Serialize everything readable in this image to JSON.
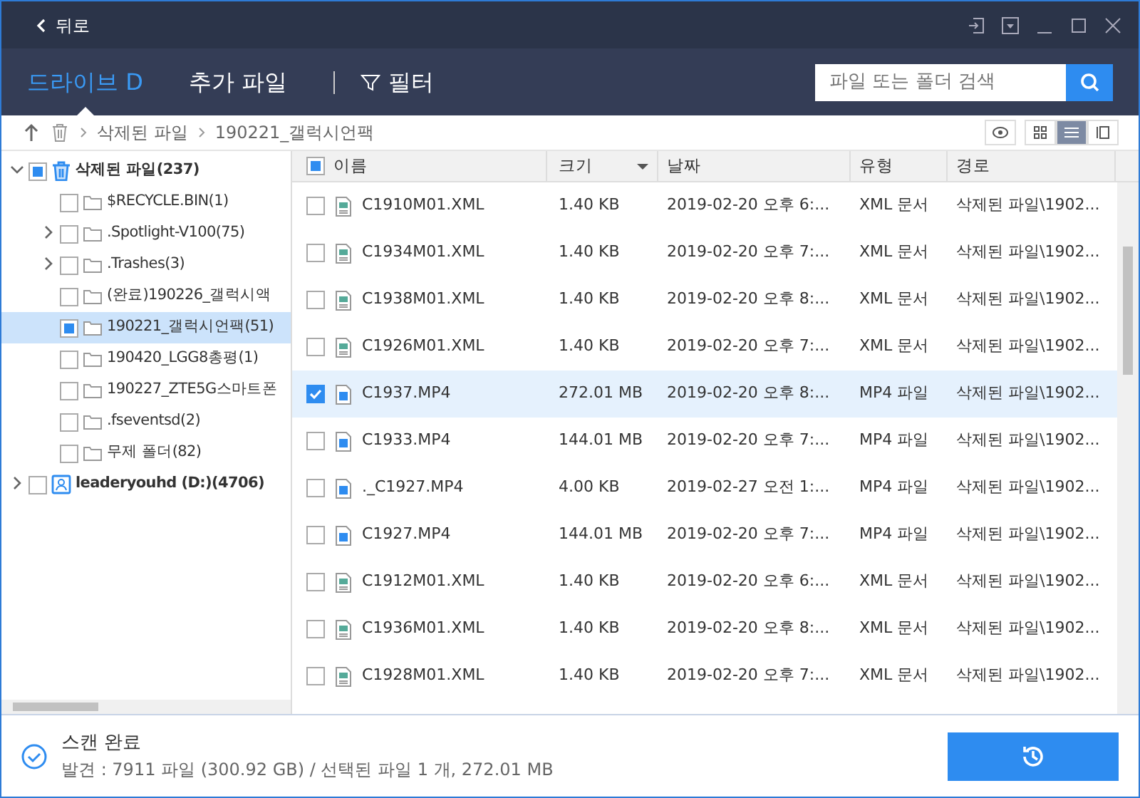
{
  "window": {
    "back_label": "뒤로"
  },
  "tabs": [
    {
      "label": "드라이브 D",
      "selected": true
    },
    {
      "label": "추가 파일",
      "selected": false
    }
  ],
  "filter": {
    "label": "필터"
  },
  "search": {
    "placeholder": "파일 또는 폴더 검색"
  },
  "breadcrumb": [
    "삭제된 파일",
    "190221_갤럭시언팩"
  ],
  "view_modes": [
    {
      "kind": "grid",
      "selected": false
    },
    {
      "kind": "list",
      "selected": true
    },
    {
      "kind": "preview",
      "selected": false
    }
  ],
  "tree": [
    {
      "label": "삭제된 파일(237)",
      "kind": "trash",
      "expanded": true,
      "checked": false,
      "indeterminate": true,
      "selected": false,
      "children": [
        {
          "label": "$RECYCLE.BIN(1)",
          "expandable": false,
          "checked": false,
          "indeterminate": false,
          "selected": false
        },
        {
          "label": ".Spotlight-V100(75)",
          "expandable": true,
          "checked": false,
          "indeterminate": false,
          "selected": false
        },
        {
          "label": ".Trashes(3)",
          "expandable": true,
          "checked": false,
          "indeterminate": false,
          "selected": false
        },
        {
          "label": "(완료)190226_갤럭시액",
          "expandable": false,
          "checked": false,
          "indeterminate": false,
          "selected": false
        },
        {
          "label": "190221_갤럭시언팩(51)",
          "expandable": false,
          "checked": false,
          "indeterminate": true,
          "selected": true
        },
        {
          "label": "190420_LGG8총평(1)",
          "expandable": false,
          "checked": false,
          "indeterminate": false,
          "selected": false
        },
        {
          "label": "190227_ZTE5G스마트폰",
          "expandable": false,
          "checked": false,
          "indeterminate": false,
          "selected": false
        },
        {
          "label": ".fseventsd(2)",
          "expandable": false,
          "checked": false,
          "indeterminate": false,
          "selected": false
        },
        {
          "label": "무제 폴더(82)",
          "expandable": false,
          "checked": false,
          "indeterminate": false,
          "selected": false
        }
      ]
    },
    {
      "label": "leaderyouhd (D:)(4706)",
      "kind": "drive",
      "expanded": false,
      "checked": false,
      "indeterminate": false,
      "selected": false
    }
  ],
  "table": {
    "header_checked": false,
    "header_indeterminate": true,
    "columns": [
      "이름",
      "크기",
      "날짜",
      "유형",
      "경로"
    ],
    "rows": [
      {
        "kind": "xml",
        "checked": false,
        "selected": false,
        "cells": [
          "C1910M01.XML",
          "1.40 KB",
          "2019-02-20 오후 6:...",
          "XML 문서",
          "삭제된 파일\\1902..."
        ]
      },
      {
        "kind": "xml",
        "checked": false,
        "selected": false,
        "cells": [
          "C1934M01.XML",
          "1.40 KB",
          "2019-02-20 오후 7:...",
          "XML 문서",
          "삭제된 파일\\1902..."
        ]
      },
      {
        "kind": "xml",
        "checked": false,
        "selected": false,
        "cells": [
          "C1938M01.XML",
          "1.40 KB",
          "2019-02-20 오후 8:...",
          "XML 문서",
          "삭제된 파일\\1902..."
        ]
      },
      {
        "kind": "xml",
        "checked": false,
        "selected": false,
        "cells": [
          "C1926M01.XML",
          "1.40 KB",
          "2019-02-20 오후 7:...",
          "XML 문서",
          "삭제된 파일\\1902..."
        ]
      },
      {
        "kind": "video",
        "checked": true,
        "selected": true,
        "cells": [
          "C1937.MP4",
          "272.01 MB",
          "2019-02-20 오후 8:...",
          "MP4 파일",
          "삭제된 파일\\1902..."
        ]
      },
      {
        "kind": "video",
        "checked": false,
        "selected": false,
        "cells": [
          "C1933.MP4",
          "144.01 MB",
          "2019-02-20 오후 7:...",
          "MP4 파일",
          "삭제된 파일\\1902..."
        ]
      },
      {
        "kind": "video",
        "checked": false,
        "selected": false,
        "cells": [
          "._C1927.MP4",
          "4.00 KB",
          "2019-02-27 오전 1:...",
          "MP4 파일",
          "삭제된 파일\\1902..."
        ]
      },
      {
        "kind": "video",
        "checked": false,
        "selected": false,
        "cells": [
          "C1927.MP4",
          "144.01 MB",
          "2019-02-20 오후 7:...",
          "MP4 파일",
          "삭제된 파일\\1902..."
        ]
      },
      {
        "kind": "xml",
        "checked": false,
        "selected": false,
        "cells": [
          "C1912M01.XML",
          "1.40 KB",
          "2019-02-20 오후 6:...",
          "XML 문서",
          "삭제된 파일\\1902..."
        ]
      },
      {
        "kind": "xml",
        "checked": false,
        "selected": false,
        "cells": [
          "C1936M01.XML",
          "1.40 KB",
          "2019-02-20 오후 8:...",
          "XML 문서",
          "삭제된 파일\\1902..."
        ]
      },
      {
        "kind": "xml",
        "checked": false,
        "selected": false,
        "cells": [
          "C1928M01.XML",
          "1.40 KB",
          "2019-02-20 오후 7:...",
          "XML 문서",
          "삭제된 파일\\1902..."
        ]
      }
    ]
  },
  "status": {
    "title": "스캔 완료",
    "detail": "발견 : 7911 파일 (300.92 GB) / 선택된 파일 1 개, 272.01 MB"
  }
}
